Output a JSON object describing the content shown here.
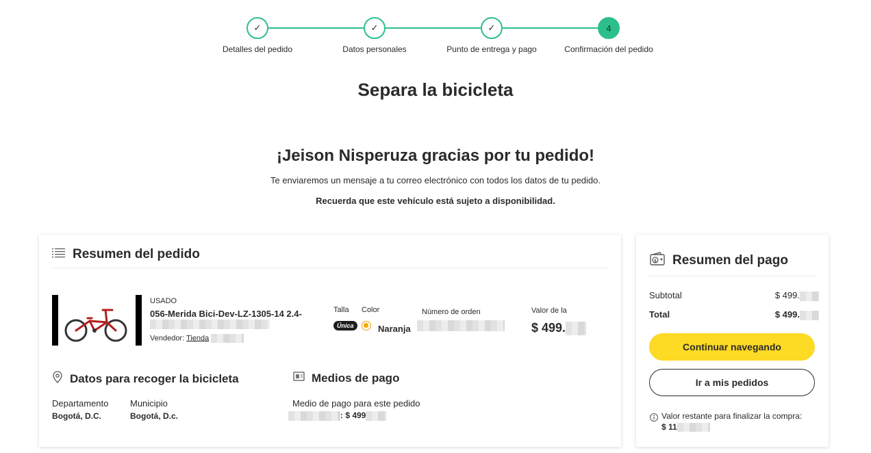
{
  "stepper": {
    "steps": [
      {
        "label": "Detalles del pedido",
        "marker": "✓"
      },
      {
        "label": "Datos personales",
        "marker": "✓"
      },
      {
        "label": "Punto de entrega y pago",
        "marker": "✓"
      },
      {
        "label": "Confirmación del pedido",
        "marker": "4"
      }
    ],
    "accent_color": "#2cbf8a"
  },
  "page_title": "Separa la bicicleta",
  "thanks": {
    "heading": "¡Jeison Nisperuza gracias por tu pedido!",
    "message": "Te enviaremos un mensaje a tu correo electrónico con todos los datos de tu pedido.",
    "notice": "Recuerda que este vehículo está sujeto a disponibilidad."
  },
  "order_summary": {
    "title": "Resumen del pedido",
    "icon": "list-icon",
    "product": {
      "condition": "USADO",
      "name": "056-Merida Bici-Dev-LZ-1305-14 2.4-",
      "seller_label": "Vendedor:",
      "seller_name": "Tienda",
      "size_label": "Talla",
      "size_value": "Única",
      "color_label": "Color",
      "color_value": "Naranja",
      "order_number_label": "Número de orden",
      "value_label": "Valor de la",
      "price": "$ 499."
    },
    "pickup": {
      "title": "Datos para recoger la bicicleta",
      "icon": "location-pin-icon",
      "department_label": "Departamento",
      "department_value": "Bogotá, D.C.",
      "municipality_label": "Municipio",
      "municipality_value": "Bogotá, D.c."
    },
    "payment_methods": {
      "title": "Medios de pago",
      "icon": "payment-card-icon",
      "label": "Medio de pago para este pedido",
      "value": ": $ 499"
    }
  },
  "payment_summary": {
    "title": "Resumen del pago",
    "icon": "wallet-icon",
    "subtotal_label": "Subtotal",
    "subtotal_value": "$ 499.",
    "total_label": "Total",
    "total_value": "$ 499.",
    "continue_button": "Continuar navegando",
    "orders_button": "Ir a mis pedidos",
    "remaining_label": "Valor restante para finalizar la compra:",
    "remaining_value": "$ 11",
    "button_color": "#fdda24"
  }
}
